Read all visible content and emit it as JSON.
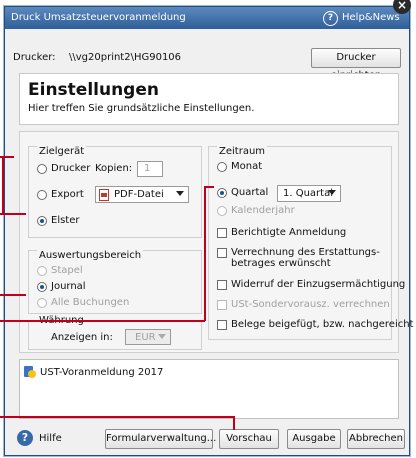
{
  "window": {
    "title": "Druck Umsatzsteuervoranmeldung",
    "help_news": "Help&News"
  },
  "printer": {
    "label": "Drucker:",
    "value": "\\\\vg20print2\\HG90106",
    "setup_button": "Drucker einrichten"
  },
  "header": {
    "title": "Einstellungen",
    "subtitle": "Hier treffen Sie grundsätzliche Einstellungen."
  },
  "zielgeraet": {
    "title": "Zielgerät",
    "drucker": {
      "label": "Drucker",
      "checked": false
    },
    "kopien_label": "Kopien:",
    "kopien_value": "1",
    "export": {
      "label": "Export",
      "checked": false
    },
    "export_format": "PDF-Datei",
    "elster": {
      "label": "Elster",
      "checked": true
    }
  },
  "auswertungsbereich": {
    "title": "Auswertungsbereich",
    "options": [
      {
        "label": "Stapel",
        "checked": false,
        "disabled": true
      },
      {
        "label": "Journal",
        "checked": true,
        "disabled": false
      },
      {
        "label": "Alle Buchungen",
        "checked": false,
        "disabled": true
      }
    ]
  },
  "waehrung": {
    "title": "Währung",
    "label": "Anzeigen in:",
    "value": "EUR"
  },
  "zeitraum": {
    "title": "Zeitraum",
    "monat": {
      "label": "Monat",
      "checked": false
    },
    "quartal": {
      "label": "Quartal",
      "checked": true
    },
    "quartal_value": "1. Quartal",
    "kalenderjahr": {
      "label": "Kalenderjahr",
      "checked": false,
      "disabled": true
    },
    "checks": [
      {
        "label": "Berichtigte Anmeldung",
        "checked": false,
        "disabled": false
      },
      {
        "label": "Verrechnung des Erstattungs-",
        "label2": "betrages erwünscht",
        "checked": false,
        "disabled": false
      },
      {
        "label": "Widerruf der Einzugsermächtigung",
        "checked": false,
        "disabled": false
      },
      {
        "label": "USt-Sondervorausz. verrechnen",
        "checked": false,
        "disabled": true
      },
      {
        "label": "Belege beigefügt, bzw. nachgereicht",
        "checked": false,
        "disabled": false
      }
    ]
  },
  "list": {
    "items": [
      "UST-Voranmeldung 2017"
    ]
  },
  "footer": {
    "hilfe": "Hilfe",
    "formularverwaltung": "Formularverwaltung...",
    "vorschau": "Vorschau",
    "ausgabe": "Ausgabe",
    "abbrechen": "Abbrechen"
  },
  "colors": {
    "accent": "#2f5f9a",
    "callout": "#c0001a"
  }
}
